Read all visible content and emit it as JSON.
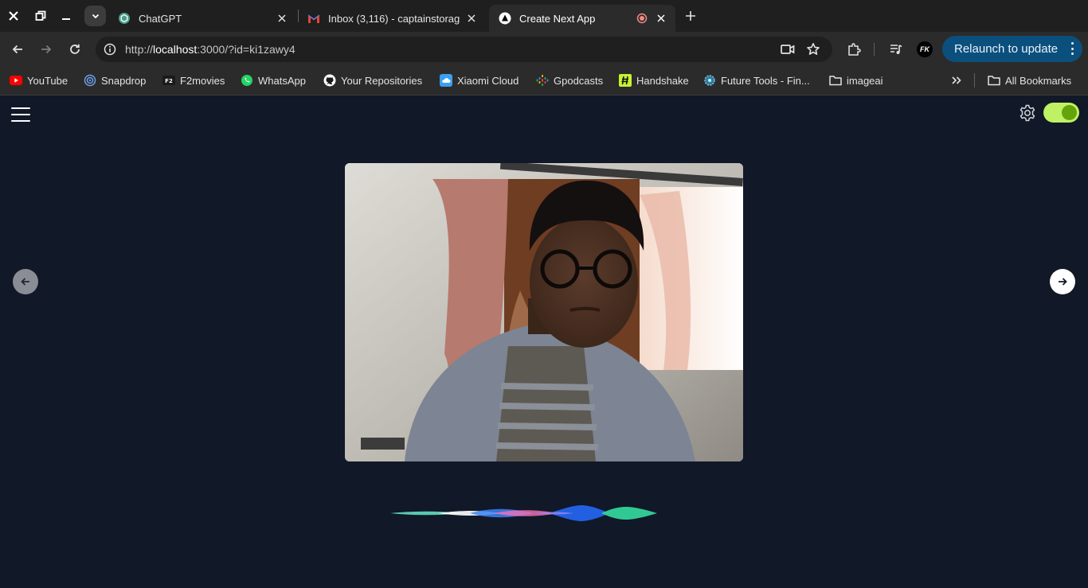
{
  "browser": {
    "tabs": [
      {
        "title": "ChatGPT",
        "icon": "chatgpt-icon",
        "active": false
      },
      {
        "title": "Inbox (3,116) - captainstorag",
        "icon": "gmail-icon",
        "active": false
      },
      {
        "title": "Create Next App",
        "icon": "nextjs-icon",
        "active": true
      }
    ],
    "url": {
      "prefix": "http://",
      "host": "localhost",
      "rest": ":3000/?id=ki1zawy4"
    },
    "profile_initials": "FK",
    "relaunch_label": "Relaunch to update",
    "bookmarks": [
      {
        "label": "YouTube",
        "icon": "youtube-icon"
      },
      {
        "label": "Snapdrop",
        "icon": "snapdrop-icon"
      },
      {
        "label": "F2movies",
        "icon": "f2movies-icon"
      },
      {
        "label": "WhatsApp",
        "icon": "whatsapp-icon"
      },
      {
        "label": "Your Repositories",
        "icon": "github-icon"
      },
      {
        "label": "Xiaomi Cloud",
        "icon": "cloud-icon"
      },
      {
        "label": "Gpodcasts",
        "icon": "podcasts-icon"
      },
      {
        "label": "Handshake",
        "icon": "handshake-icon"
      },
      {
        "label": "Future Tools - Fin...",
        "icon": "futuretools-icon"
      },
      {
        "label": "imageai",
        "icon": "folder-icon"
      }
    ],
    "all_bookmarks_label": "All Bookmarks"
  },
  "app": {
    "toggle_on": true,
    "accent_color": "#bef264",
    "background_color": "#111827"
  }
}
